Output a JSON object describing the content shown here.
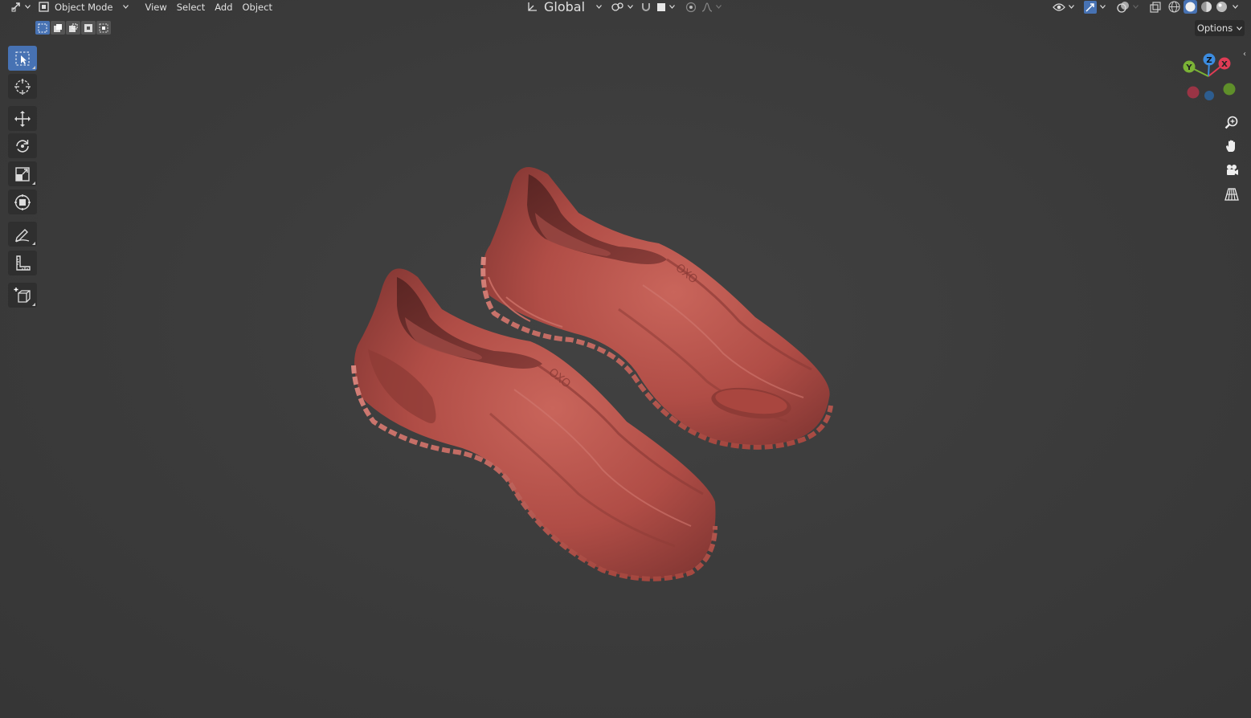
{
  "header": {
    "mode_label": "Object Mode",
    "menus": [
      "View",
      "Select",
      "Add",
      "Object"
    ],
    "transform_orientation": "Global",
    "icons": {
      "editor_type": "transform-icon",
      "mode": "object-mode-icon",
      "orientation": "orientation-icon",
      "pivot": "pivot-link-icon",
      "snap": "magnet-icon",
      "snap_target": "square-icon",
      "proportional": "proportional-edit-icon",
      "falloff": "falloff-curve-icon",
      "visibility": "eye-icon",
      "gizmos": "gizmo-icon",
      "overlays": "overlay-icon",
      "xray": "xray-icon",
      "shading_wire": "wireframe-sphere-icon",
      "shading_solid": "solid-sphere-icon",
      "shading_material": "material-sphere-icon",
      "shading_rendered": "rendered-sphere-icon"
    }
  },
  "toolbar": {
    "options_label": "Options",
    "tools": [
      {
        "name": "select-box-tool",
        "icon": "select-box-icon",
        "active": true
      },
      {
        "name": "cursor-tool",
        "icon": "cursor-icon",
        "active": false
      },
      {
        "name": "move-tool",
        "icon": "move-icon",
        "active": false
      },
      {
        "name": "rotate-tool",
        "icon": "rotate-icon",
        "active": false
      },
      {
        "name": "scale-tool",
        "icon": "scale-icon",
        "active": false
      },
      {
        "name": "transform-tool",
        "icon": "transform-icon",
        "active": false
      },
      {
        "name": "annotate-tool",
        "icon": "pencil-icon",
        "active": false
      },
      {
        "name": "measure-tool",
        "icon": "ruler-icon",
        "active": false
      },
      {
        "name": "add-cube-tool",
        "icon": "add-cube-icon",
        "active": false
      }
    ]
  },
  "gizmo": {
    "axes": [
      "X",
      "Y",
      "Z"
    ],
    "colors": {
      "x": "#e03c55",
      "y": "#7bb336",
      "z": "#3c8ce0"
    }
  },
  "navigation": [
    "zoom-icon",
    "hand-pan-icon",
    "camera-icon",
    "grid-perspective-icon"
  ],
  "theme": {
    "accent": "#4772b3",
    "viewport_bg": "#3d3d3d",
    "shoe_color": "#b8524b"
  }
}
